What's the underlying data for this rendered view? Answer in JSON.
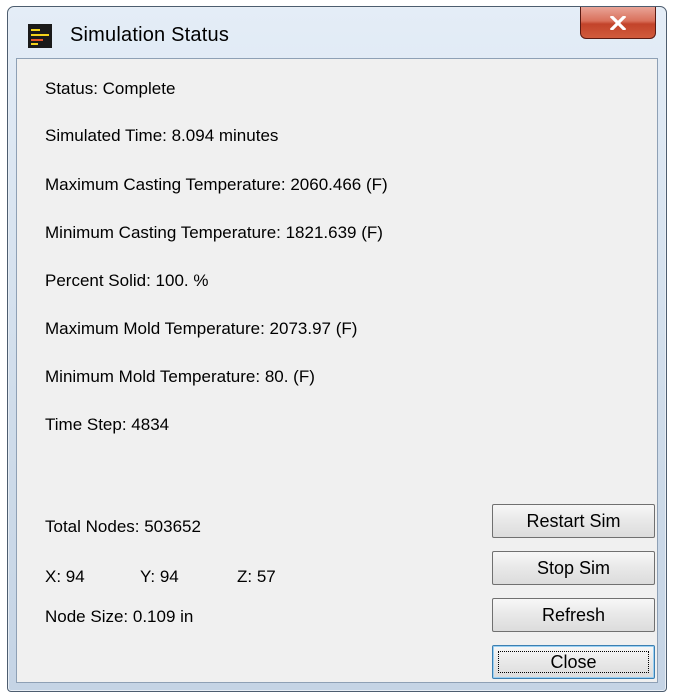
{
  "window": {
    "title": "Simulation Status",
    "close_glyph": "X",
    "app_icon": "simulation-app-icon"
  },
  "status": {
    "status": "Status: Complete",
    "simulated_time": "Simulated Time: 8.094 minutes",
    "max_casting_temp": "Maximum Casting Temperature: 2060.466 (F)",
    "min_casting_temp": "Minimum Casting Temperature: 1821.639 (F)",
    "percent_solid": "Percent Solid: 100. %",
    "max_mold_temp": "Maximum Mold Temperature: 2073.97 (F)",
    "min_mold_temp": "Minimum Mold Temperature: 80. (F)",
    "time_step": "Time Step: 4834"
  },
  "mesh": {
    "total_nodes": "Total Nodes: 503652",
    "x": "X: 94",
    "y": "Y: 94",
    "z": "Z: 57",
    "node_size": "Node Size: 0.109 in"
  },
  "buttons": {
    "restart": "Restart Sim",
    "stop": "Stop Sim",
    "refresh": "Refresh",
    "close": "Close"
  },
  "colors": {
    "client_bg": "#f0f0f0",
    "close_button": "#c2432a",
    "frame": "#cfdcea"
  }
}
